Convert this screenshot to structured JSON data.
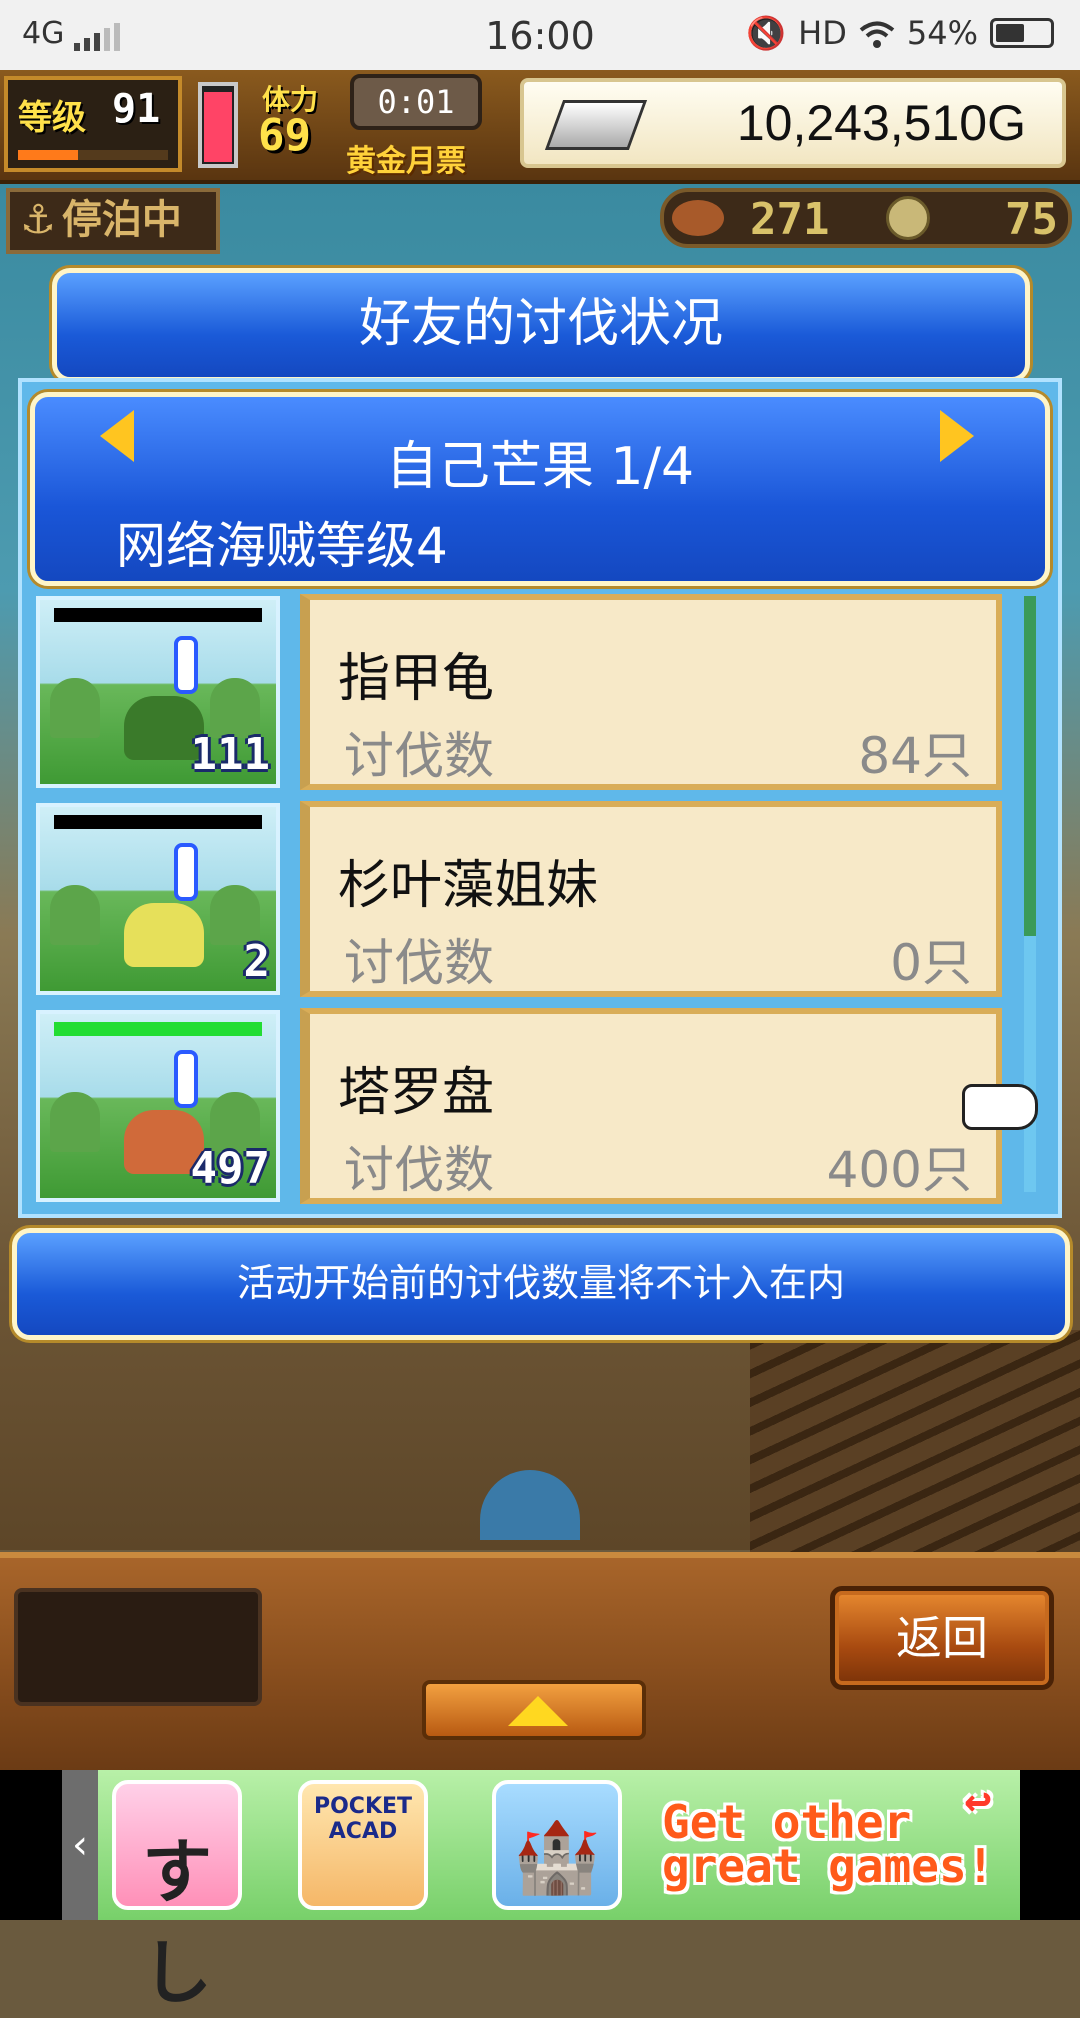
{
  "status_bar": {
    "network": "4G",
    "time": "16:00",
    "hd": "HD",
    "battery": "54%",
    "battery_level": 0.54
  },
  "hud": {
    "level_label": "等级",
    "level_value": "91",
    "stamina_label": "体力",
    "stamina_value": "69",
    "timer": "0:01",
    "event_label": "黄金月票",
    "money": "10,243,510G",
    "dock_status": "停泊中",
    "resource_1": "271",
    "resource_2": "75"
  },
  "dialog": {
    "title": "好友的讨伐状况",
    "friend_header": "自己芒果 1/4",
    "rank_label": "网络海贼等级4",
    "prev_icon": "arrow-left-icon",
    "next_icon": "arrow-right-icon"
  },
  "monsters": [
    {
      "name": "指甲龟",
      "kill_label": "讨伐数",
      "kills": "84只",
      "level": "111",
      "hp_bar": "black",
      "color": "#3a7a2a"
    },
    {
      "name": "杉叶藻姐妹",
      "kill_label": "讨伐数",
      "kills": "0只",
      "level": "2",
      "hp_bar": "black",
      "color": "#e6e05a"
    },
    {
      "name": "塔罗盘",
      "kill_label": "讨伐数",
      "kills": "400只",
      "level": "497",
      "hp_bar": "green",
      "color": "#d06a3a"
    }
  ],
  "notice": "活动开始前的讨伐数量将不计入在内",
  "buttons": {
    "back": "返回",
    "up_icon": "triangle-up-icon"
  },
  "ad": {
    "tile2_title": "POCKET ACAD",
    "cta_line1": "Get other",
    "cta_line2": "great games!"
  }
}
